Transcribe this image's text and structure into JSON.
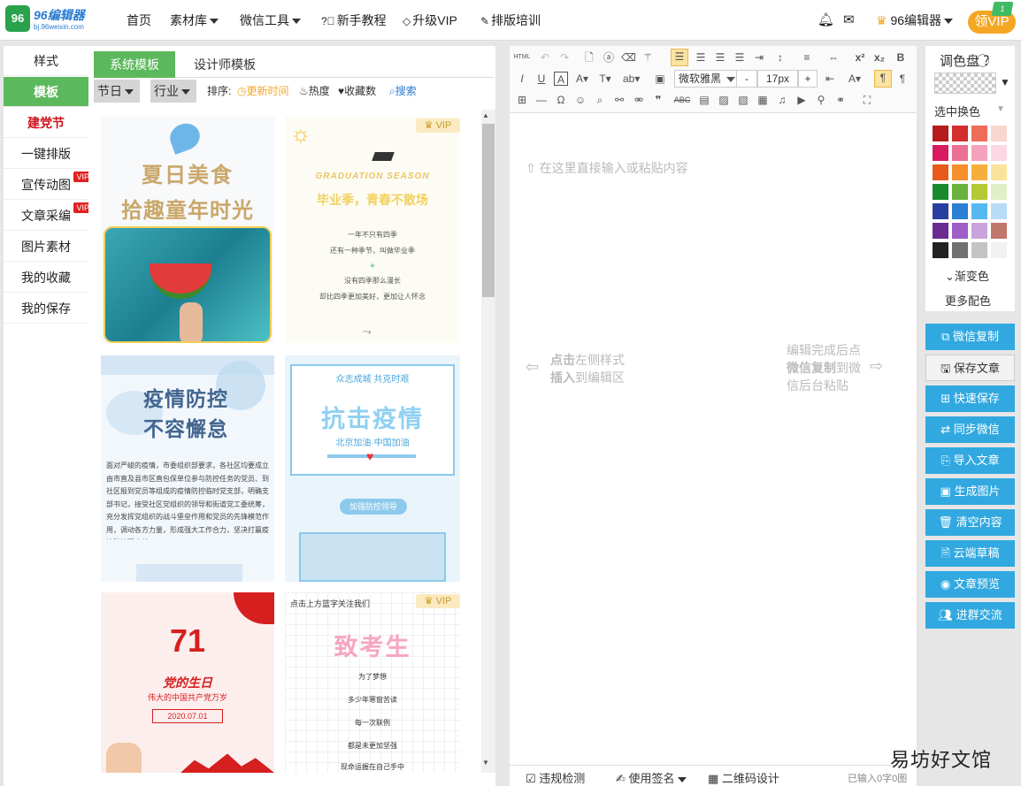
{
  "logo": {
    "mark": "96",
    "name": "96编辑器",
    "domain": "bj.96weixin.com"
  },
  "nav": {
    "items": [
      "首页",
      "素材库",
      "微信工具",
      "新手教程",
      "升级VIP",
      "排版培训"
    ],
    "user_name": "96编辑器",
    "vip_button": "领VIP",
    "vip_badge": "1"
  },
  "sidebar": {
    "items": [
      "样式",
      "模板",
      "建党节",
      "一键排版",
      "宣传动图",
      "文章采编",
      "图片素材",
      "我的收藏",
      "我的保存"
    ],
    "vip_label": "VIP"
  },
  "templates": {
    "tabs": [
      "系统模板",
      "设计师模板"
    ],
    "filters": {
      "festival": "节日",
      "industry": "行业"
    },
    "sort_label": "排序:",
    "sort_options": [
      "更新时间",
      "热度",
      "收藏数"
    ],
    "search": "搜索",
    "vip": "VIP",
    "cards": {
      "c1": {
        "title1": "夏日美食",
        "title2": "拾趣童年时光"
      },
      "c2": {
        "season": "GRADUATION SEASON",
        "title": "毕业季，青春不散场",
        "lines": [
          "一年不只有四季",
          "还有一种季节，叫做毕业季",
          "没有四季那么漫长",
          "却比四季更加美好，更加让人怀念"
        ]
      },
      "c3": {
        "title1": "疫情防控",
        "title2": "不容懈怠",
        "body": "面对严峻的疫情，市委组织部要求，各社区均要成立由市直及县市区直包保单位参与防控任务的党员、到社区报到党员等组成的疫情防控临时党支部，明确支部书记，接受社区党组织的领导和街道党工委统筹，充分发挥党组织的战斗堡垒作用和党员的先锋模范作用，调动各方力量，形成强大工作合力，坚决打赢疫情防控阻击战。"
      },
      "c4": {
        "top": "众志成城 共克时艰",
        "title": "抗击疫情",
        "sub": "北京加油·中国加油",
        "tag": "加强防控领导"
      },
      "c5": {
        "num": "71",
        "title": "党的生日",
        "sub": "伟大的中国共产党万岁",
        "date": "2020.07.01"
      },
      "c6": {
        "top": "点击上方蓝字关注我们",
        "title": "致考生",
        "lines": [
          "为了梦想",
          "多少年寒窗苦读",
          "每一次联例",
          "都是未更加坚强",
          "现命运握在自己手中"
        ]
      }
    }
  },
  "editor": {
    "font": "微软雅黑",
    "font_size": "17px",
    "placeholder": "在这里直接输入或粘贴内容",
    "hint_left": [
      "点击",
      "左侧样式",
      "插入",
      "到编辑区"
    ],
    "hint_right": [
      "编辑完成后点",
      "微信复制",
      "到微",
      "信后台粘贴"
    ],
    "footer": {
      "check": "违规检测",
      "sign": "使用签名",
      "qr": "二维码设计",
      "count": "已输入0字0图"
    },
    "html_label": "HTML"
  },
  "palette": {
    "title": "调色盘",
    "select_label": "选中换色",
    "gradient": "渐变色",
    "more": "更多配色",
    "colors": [
      "#b71c1c",
      "#d32f2f",
      "#ef6c5a",
      "#f9d6cf",
      "#d81b60",
      "#ec6f95",
      "#f4a3bd",
      "#fbd8e4",
      "#e8591a",
      "#f7902b",
      "#f5b03c",
      "#fbe39b",
      "#1b8a2e",
      "#69b23d",
      "#b5c934",
      "#e1efc8",
      "#283f9e",
      "#2b7fd4",
      "#57b7f0",
      "#b8dcf5",
      "#6a2c91",
      "#a05cc7",
      "#caa3dc",
      "#c0786a",
      "#222222",
      "#707070",
      "#c4c4c4",
      "#f2f2f2"
    ]
  },
  "actions": [
    "微信复制",
    "保存文章",
    "快速保存",
    "同步微信",
    "导入文章",
    "生成图片",
    "清空内容",
    "云端草稿",
    "文章预览",
    "进群交流"
  ],
  "watermark": "易坊好文馆"
}
